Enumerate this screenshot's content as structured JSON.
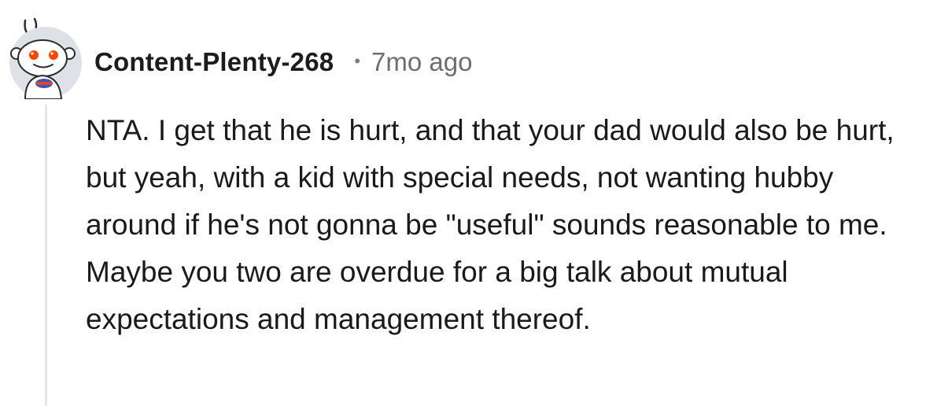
{
  "comment": {
    "author": "Content-Plenty-268",
    "separator": "•",
    "timestamp": "7mo ago",
    "body": "NTA. I get that he is hurt, and that your dad would also be hurt, but yeah, with a kid with special needs, not wanting hubby around if he's not gonna be \"useful\" sounds reasonable to me. Maybe you two are overdue for a big talk about mutual expectations and management thereof.",
    "avatar_icon": "reddit-snoo-avatar-icon"
  },
  "colors": {
    "username": "#1c1c1c",
    "timestamp": "#6b6f73",
    "body": "#1a1a1b",
    "thread_line": "#e4e6e8",
    "avatar_bg": "#dee1e5",
    "snoo_orange": "#ff4500"
  }
}
